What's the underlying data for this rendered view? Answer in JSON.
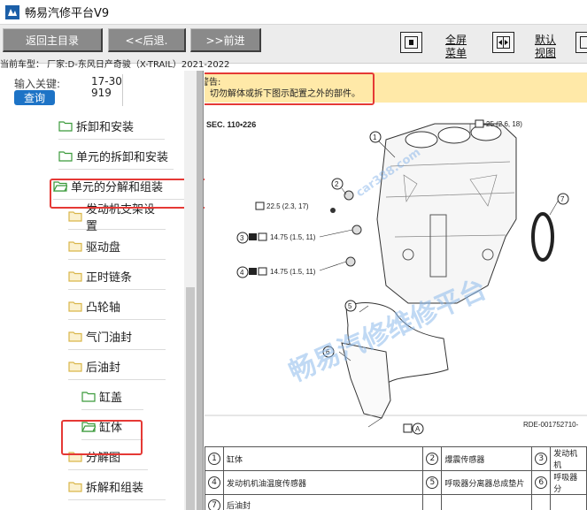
{
  "app": {
    "title": "畅易汽修平台V9"
  },
  "toolbar": {
    "main_menu": "返回主目录",
    "back": "<<后退.",
    "forward": ">>前进",
    "fullscreen_line1": "全屏",
    "fullscreen_line2": "菜单",
    "default_line1": "默认",
    "default_line2": "视图"
  },
  "car_info": "当前车型： 厂家:D-东风日产奇骏（X-TRAIL）2021-2022",
  "search": {
    "label": "输入关键:",
    "value": "17-30919",
    "button": "查询"
  },
  "tree": [
    {
      "label": "拆卸和安装",
      "type": "folder"
    },
    {
      "label": "单元的拆卸和安装",
      "type": "folder"
    },
    {
      "label": "单元的分解和组装",
      "type": "folder-open"
    },
    {
      "label": "发动机支架设置",
      "type": "folder"
    },
    {
      "label": "驱动盘",
      "type": "folder"
    },
    {
      "label": "正时链条",
      "type": "folder"
    },
    {
      "label": "凸轮轴",
      "type": "folder"
    },
    {
      "label": "气门油封",
      "type": "folder"
    },
    {
      "label": "后油封",
      "type": "folder"
    },
    {
      "label": "缸盖",
      "type": "folder"
    },
    {
      "label": "缸体",
      "type": "folder-open"
    },
    {
      "label": "分解图",
      "type": "folder"
    },
    {
      "label": "拆解和组装",
      "type": "folder"
    }
  ],
  "warning": {
    "label": "警告:",
    "text": "切勿解体或拆下图示配置之外的部件。"
  },
  "figure": {
    "sec": "SEC. 110•226",
    "ref": "RDE-001752710-",
    "torque_top": "25 (2.6, 18)",
    "torque_left": "22.5 (2.3, 17)",
    "torque_3": "14.75 (1.5, 11)",
    "torque_4": "14.75 (1.5, 11)",
    "num1": "1",
    "num2": "2",
    "num3": "3",
    "num4": "4",
    "num5": "5",
    "num6": "6",
    "num7": "7",
    "letter_a": "A",
    "watermark_url": "car388.com"
  },
  "parts": [
    {
      "n1": "1",
      "p1": "缸体",
      "n2": "2",
      "p2": "爆震传感器",
      "n3": "3",
      "p3": "发动机机"
    },
    {
      "n1": "4",
      "p1": "发动机机油温度传感器",
      "n2": "5",
      "p2": "呼吸器分离器总成垫片",
      "n3": "6",
      "p3": "呼吸器分"
    },
    {
      "n1": "7",
      "p1": "后油封",
      "n2": "",
      "p2": "",
      "n3": "",
      "p3": ""
    }
  ],
  "watermark": "畅易汽修维修平台",
  "colors": {
    "accent": "#1d73c6",
    "highlight": "#e53935",
    "warning_bg": "#ffe9a8",
    "button": "#8a8a8a"
  }
}
